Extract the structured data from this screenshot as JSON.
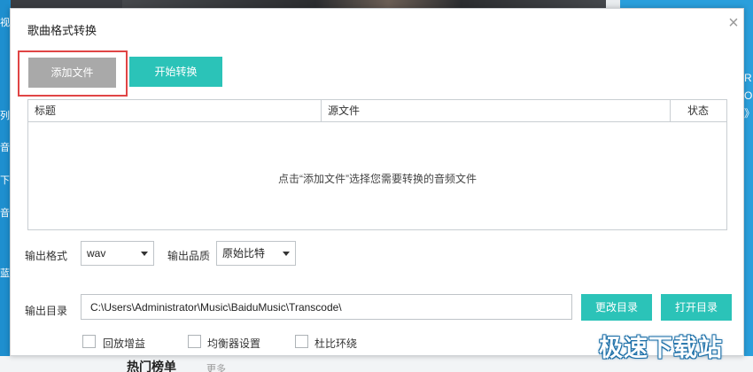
{
  "background": {
    "left_glyphs": [
      "视",
      "列",
      "音",
      "下",
      "音",
      "蓝"
    ],
    "right_glyphs": [
      "R",
      "O",
      "》"
    ],
    "bottom_text": "热门榜单",
    "bottom_more": "更多"
  },
  "dialog": {
    "title": "歌曲格式转换",
    "close_glyph": "×"
  },
  "toolbar": {
    "add_file_label": "添加文件",
    "start_convert_label": "开始转换"
  },
  "table": {
    "columns": [
      "标题",
      "源文件",
      "状态"
    ],
    "empty_hint": "点击“添加文件”选择您需要转换的音频文件"
  },
  "output": {
    "format_label": "输出格式",
    "format_value": "wav",
    "quality_label": "输出品质",
    "quality_value": "原始比特",
    "dir_label": "输出目录",
    "dir_value": "C:\\Users\\Administrator\\Music\\BaiduMusic\\Transcode\\",
    "change_dir_label": "更改目录",
    "open_dir_label": "打开目录"
  },
  "effects": {
    "items": [
      {
        "label": "回放增益",
        "checked": false
      },
      {
        "label": "均衡器设置",
        "checked": false
      },
      {
        "label": "杜比环绕",
        "checked": false
      }
    ]
  },
  "watermark": "极速下载站",
  "colors": {
    "accent": "#2bc3b8",
    "disabled_button": "#a9a9a9",
    "highlight_border": "#e04545",
    "app_blue": "#2a9fdc"
  }
}
